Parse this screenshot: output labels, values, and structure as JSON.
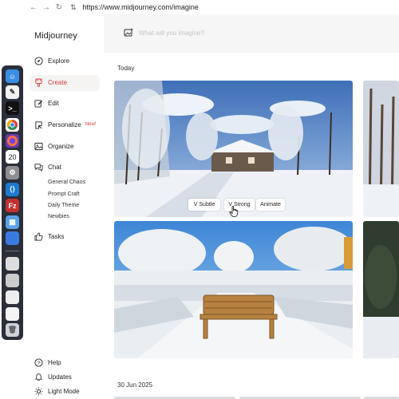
{
  "browser": {
    "url": "https://www.midjourney.com/imagine",
    "back_icon": "arrow-left-icon",
    "forward_icon": "arrow-right-icon",
    "reload_icon": "reload-icon"
  },
  "sidebar": {
    "brand": "Midjourney",
    "items": [
      {
        "label": "Explore",
        "icon": "compass-icon"
      },
      {
        "label": "Create",
        "icon": "brush-icon",
        "active": true
      },
      {
        "label": "Edit",
        "icon": "edit-icon"
      },
      {
        "label": "Personalize",
        "icon": "palette-icon",
        "badge": "New!"
      },
      {
        "label": "Organize",
        "icon": "image-icon"
      },
      {
        "label": "Chat",
        "icon": "chat-icon"
      }
    ],
    "chat_rooms": [
      "General Chaos",
      "Prompt Craft",
      "Daily Theme",
      "Newbies"
    ],
    "tasks": {
      "label": "Tasks",
      "icon": "thumbs-up-icon"
    },
    "footer": [
      {
        "label": "Help",
        "icon": "help-icon"
      },
      {
        "label": "Updates",
        "icon": "bell-icon"
      },
      {
        "label": "Light Mode",
        "icon": "sun-icon"
      }
    ]
  },
  "main": {
    "prompt_placeholder": "What will you imagine?",
    "sections": [
      "Today",
      "30 Jun 2025"
    ],
    "image_actions": [
      "V Subtle",
      "V Strong",
      "Animate"
    ]
  },
  "dock": {
    "apps": [
      "finder-icon",
      "pen-icon",
      "terminal-icon",
      "chrome-icon",
      "firefox-icon",
      "calendar-icon",
      "settings-icon",
      "vscode-icon",
      "filezilla-icon",
      "app-icon",
      "app-icon",
      "trash-icon"
    ],
    "calendar_day": "20"
  },
  "colors": {
    "accent": "#d23b3b",
    "sidebar_bg": "#ffffff",
    "prompt_bg": "#f6f6f6"
  }
}
